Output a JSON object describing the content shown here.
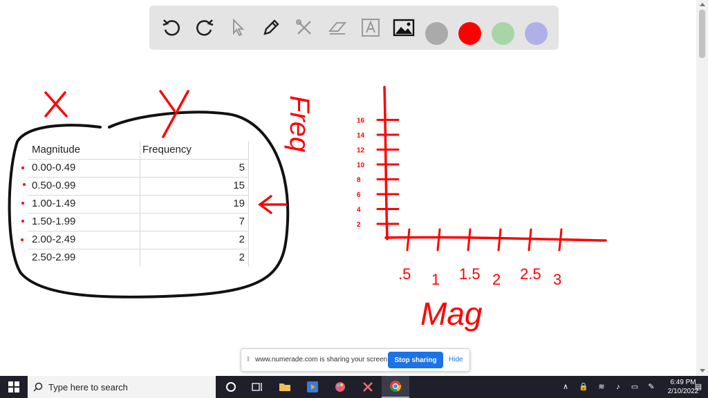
{
  "toolbar": {
    "tools": [
      "undo-icon",
      "redo-icon",
      "select-pointer-icon",
      "pen-icon",
      "tools-icon",
      "eraser-icon",
      "text-icon",
      "image-icon"
    ],
    "swatches": [
      "#aaaaaa",
      "#ff0000",
      "#a8d5a8",
      "#b0b0e8"
    ]
  },
  "table": {
    "headers": {
      "magnitude": "Magnitude",
      "frequency": "Frequency"
    },
    "rows": [
      {
        "magnitude": "0.00-0.49",
        "frequency": "5"
      },
      {
        "magnitude": "0.50-0.99",
        "frequency": "15"
      },
      {
        "magnitude": "1.00-1.49",
        "frequency": "19"
      },
      {
        "magnitude": "1.50-1.99",
        "frequency": "7"
      },
      {
        "magnitude": "2.00-2.49",
        "frequency": "2"
      },
      {
        "magnitude": "2.50-2.99",
        "frequency": "2"
      }
    ]
  },
  "annotations": {
    "x_label": "X",
    "y_label": "Y",
    "freq_label": "Freq",
    "mag_label": "Mag",
    "x_ticks": [
      ".5",
      "1",
      "1.5",
      "2",
      "2.5",
      "3"
    ],
    "y_ticks": [
      "2",
      "4",
      "6",
      "8",
      "10",
      "12",
      "14",
      "16"
    ],
    "ink_color": "#ff0000"
  },
  "share_bar": {
    "message": "www.numerade.com is sharing your screen.",
    "stop_label": "Stop sharing",
    "hide_label": "Hide"
  },
  "taskbar": {
    "search_placeholder": "Type here to search",
    "time": "6:49 PM",
    "date": "2/10/2022"
  }
}
